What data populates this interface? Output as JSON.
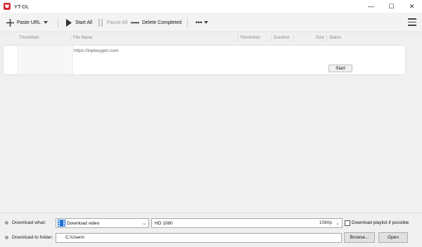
{
  "window": {
    "title": "YT-DL",
    "controls": {
      "minimize": "—",
      "maximize": "☐",
      "close": "✕"
    }
  },
  "toolbar": {
    "paste_url": "Paste URL",
    "start_all": "Start All",
    "pause_all": "Pause All",
    "delete_completed": "Delete Completed",
    "more": "•••"
  },
  "table": {
    "columns": [
      "Thumbnail",
      "File Name",
      "Resolution",
      "Duration",
      "Size",
      "Status"
    ],
    "rows": [
      {
        "file_name": "https://topkeygen.com",
        "action": "Start"
      }
    ]
  },
  "bottom": {
    "download_what_label": "Download what:",
    "download_type": "Download video",
    "quality": "HD 1080",
    "quality_tag": "1080p",
    "playlist_label": "Download playlist if possible",
    "folder_label": "Download to folder:",
    "folder_path": "C:\\Users\\",
    "browse": "Browse...",
    "open": "Open"
  },
  "colors": {
    "brand": "#d6282d",
    "film_icon": "#1f73d6"
  }
}
